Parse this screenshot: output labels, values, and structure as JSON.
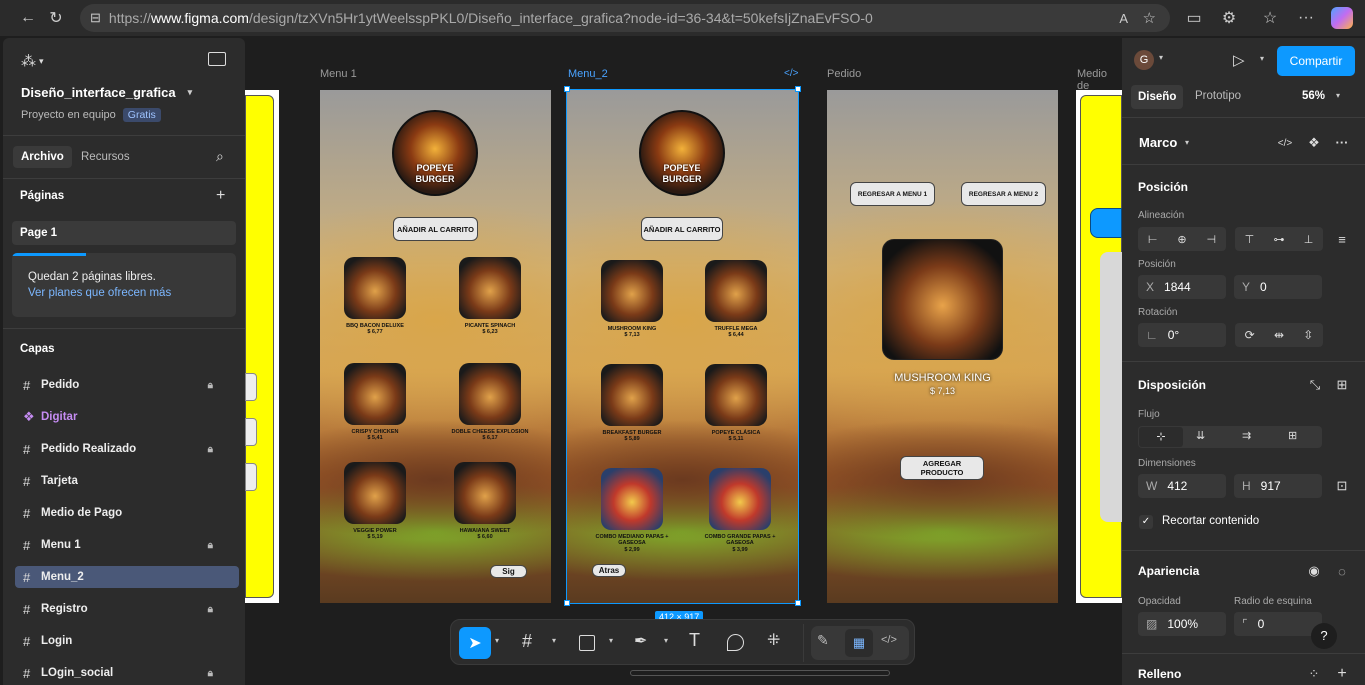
{
  "browser": {
    "url_prefix": "https://",
    "url_host": "www.figma.com",
    "url_path": "/design/tzXVn5Hr1ytWeelsspPKL0/Diseño_interface_grafica?node-id=36-34&t=50kefsIjZnaEvFSO-0"
  },
  "left_panel": {
    "file_name": "Diseño_interface_grafica",
    "project": "Proyecto en equipo",
    "plan_badge": "Gratis",
    "tabs": [
      "Archivo",
      "Recursos"
    ],
    "pages_title": "Páginas",
    "current_page": "Page 1",
    "notice_text": "Quedan 2 páginas libres.",
    "notice_link": "Ver planes que ofrecen más",
    "layers_title": "Capas",
    "layers": [
      {
        "name": "Pedido",
        "icon": "frame-icon",
        "locked": true
      },
      {
        "name": "Digitar",
        "icon": "component-icon",
        "locked": false
      },
      {
        "name": "Pedido Realizado",
        "icon": "frame-icon",
        "locked": true
      },
      {
        "name": "Tarjeta",
        "icon": "frame-icon",
        "locked": false
      },
      {
        "name": "Medio de Pago",
        "icon": "frame-icon",
        "locked": false
      },
      {
        "name": "Menu 1",
        "icon": "frame-icon",
        "locked": true
      },
      {
        "name": "Menu_2",
        "icon": "frame-icon",
        "locked": false,
        "selected": true
      },
      {
        "name": "Registro",
        "icon": "frame-icon",
        "locked": true
      },
      {
        "name": "Login",
        "icon": "frame-icon",
        "locked": false
      },
      {
        "name": "LOgin_social",
        "icon": "frame-icon",
        "locked": true
      }
    ]
  },
  "canvas": {
    "frame_labels": [
      "Menu 1",
      "Menu_2",
      "Pedido",
      "Medio de"
    ],
    "size_badge": "412 × 917",
    "logo_line1": "POPEYE",
    "logo_line2": "BURGER",
    "add_to_cart": "AÑADIR AL CARRITO",
    "menu1_products": [
      {
        "name": "BBQ BACON DELUXE",
        "price": "$ 6,77"
      },
      {
        "name": "PICANTE SPINACH",
        "price": "$ 6,23"
      },
      {
        "name": "CRISPY CHICKEN",
        "price": "$ 5,41"
      },
      {
        "name": "DOBLE CHEESE EXPLOSION",
        "price": "$ 6,17"
      },
      {
        "name": "VEGGIE POWER",
        "price": "$ 5,19"
      },
      {
        "name": "HAWAIANA SWEET",
        "price": "$ 6,60"
      }
    ],
    "menu1_next": "Sig",
    "menu2_products": [
      {
        "name": "MUSHROOM KING",
        "price": "$ 7,13"
      },
      {
        "name": "TRUFFLE MEGA",
        "price": "$ 6,44"
      },
      {
        "name": "BREAKFAST BURGER",
        "price": "$ 5,89"
      },
      {
        "name": "POPEYE CLÁSICA",
        "price": "$ 5,11"
      },
      {
        "name": "COMBO MEDIANO PAPAS + GASEOSA",
        "price": "$ 2,99"
      },
      {
        "name": "COMBO GRANDE PAPAS + GASEOSA",
        "price": "$ 3,99"
      }
    ],
    "menu2_back": "Atras",
    "pedido_back1": "REGRESAR A MENU 1",
    "pedido_back2": "REGRESAR A MENU 2",
    "pedido_product": "MUSHROOM KING",
    "pedido_price": "$ 7,13",
    "pedido_add": "AGREGAR PRODUCTO"
  },
  "toolbar": {
    "tools": [
      "move-tool-icon",
      "frame-tool-icon",
      "rectangle-tool-icon",
      "pen-tool-icon",
      "text-tool-icon",
      "comment-tool-icon",
      "actions-icon",
      "draw-mode-icon",
      "design-mode-icon",
      "dev-mode-icon"
    ]
  },
  "right_panel": {
    "avatar_letter": "G",
    "share_label": "Compartir",
    "tabs": [
      "Diseño",
      "Prototipo"
    ],
    "zoom": "56%",
    "selection_type": "Marco",
    "position_title": "Posición",
    "alignment_label": "Alineación",
    "position_label": "Posición",
    "x_label": "X",
    "x_value": "1844",
    "y_label": "Y",
    "y_value": "0",
    "rotation_label": "Rotación",
    "rotation_value": "0°",
    "layout_title": "Disposición",
    "flow_label": "Flujo",
    "dimensions_label": "Dimensiones",
    "w_label": "W",
    "w_value": "412",
    "h_label": "H",
    "h_value": "917",
    "clip_label": "Recortar contenido",
    "appearance_title": "Apariencia",
    "opacity_label": "Opacidad",
    "opacity_value": "100%",
    "radius_label": "Radio de esquina",
    "radius_value": "0",
    "fill_title": "Relleno",
    "help": "?"
  },
  "colors": {
    "accent": "#0d99ff",
    "selected_layer": "#4a5878",
    "component": "#c58cf2",
    "frame_yellow": "#ffff00"
  }
}
